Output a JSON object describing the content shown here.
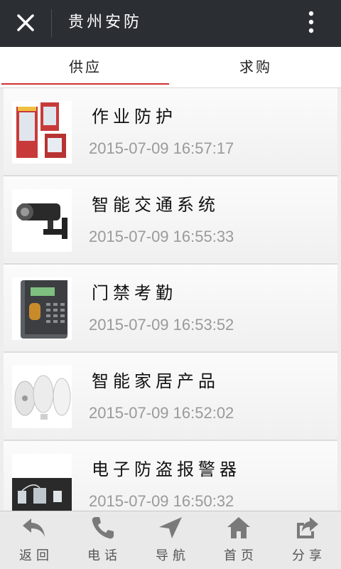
{
  "header": {
    "title": "贵州安防",
    "close_icon": "close-icon",
    "more_icon": "more-vertical-icon"
  },
  "tabs": [
    {
      "label": "供应",
      "active": true
    },
    {
      "label": "求购",
      "active": false
    }
  ],
  "items": [
    {
      "name": "作业防护",
      "date": "2015-07-09 16:57:17",
      "image": "protective-booth"
    },
    {
      "name": "智能交通系统",
      "date": "2015-07-09 16:55:33",
      "image": "surveillance-camera"
    },
    {
      "name": "门禁考勤",
      "date": "2015-07-09 16:53:52",
      "image": "fingerprint-terminal"
    },
    {
      "name": "智能家居产品",
      "date": "2015-07-09 16:52:02",
      "image": "smart-home-devices"
    },
    {
      "name": "电子防盗报警器",
      "date": "2015-07-09 16:50:32",
      "image": "anti-theft-alarm"
    }
  ],
  "bottom_nav": [
    {
      "label": "返回",
      "icon": "back-arrow-icon"
    },
    {
      "label": "电话",
      "icon": "phone-icon"
    },
    {
      "label": "导航",
      "icon": "navigation-arrow-icon"
    },
    {
      "label": "首页",
      "icon": "home-icon"
    },
    {
      "label": "分享",
      "icon": "share-icon"
    }
  ],
  "colors": {
    "topbar": "#2b2f33",
    "tab_underline": "#d03030",
    "date_text": "#9a9a9a"
  }
}
